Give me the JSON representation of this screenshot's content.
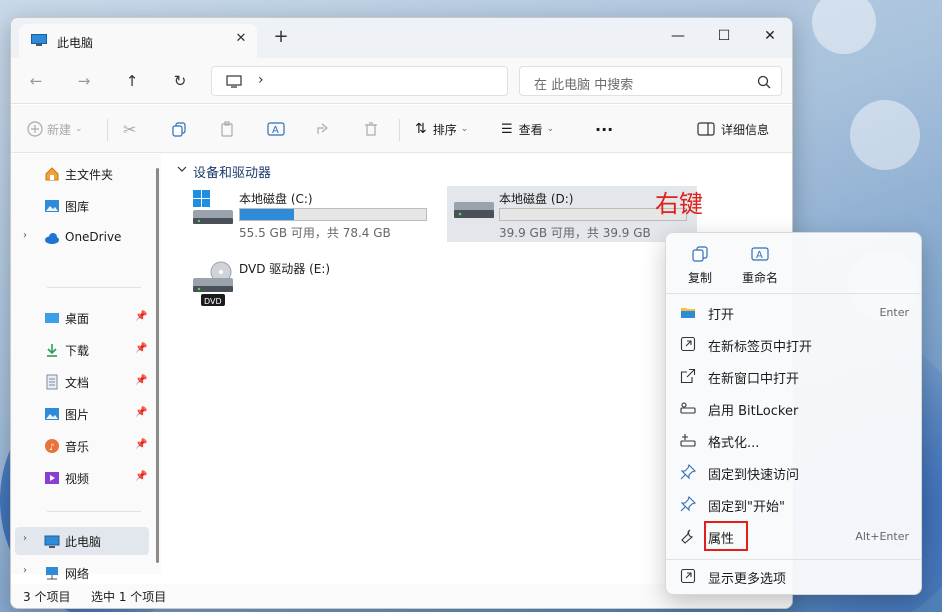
{
  "window": {
    "tab_title": "此电脑",
    "tab_close": "✕",
    "new_tab": "+",
    "minimize": "—",
    "maximize": "☐",
    "close": "✕"
  },
  "address": {
    "chevron": "›",
    "search_placeholder": "在 此电脑 中搜索"
  },
  "toolbar": {
    "new_label": "新建",
    "sort_label": "排序",
    "view_label": "查看",
    "more_label": "···",
    "details_label": "详细信息"
  },
  "nav": {
    "items": [
      {
        "label": "主文件夹"
      },
      {
        "label": "图库"
      },
      {
        "label": "OneDrive"
      },
      {
        "label": "桌面"
      },
      {
        "label": "下载"
      },
      {
        "label": "文档"
      },
      {
        "label": "图片"
      },
      {
        "label": "音乐"
      },
      {
        "label": "视频"
      },
      {
        "label": "此电脑"
      },
      {
        "label": "网络"
      }
    ]
  },
  "content": {
    "group_header": "设备和驱动器",
    "drives": [
      {
        "name": "本地磁盘 (C:)",
        "info": "55.5 GB 可用，共 78.4 GB",
        "used_fraction": 0.29
      },
      {
        "name": "本地磁盘 (D:)",
        "info": "39.9 GB 可用，共 39.9 GB",
        "used_fraction": 0.0
      },
      {
        "name": "DVD 驱动器 (E:)",
        "badge": "DVD"
      }
    ]
  },
  "status": {
    "count": "3 个项目",
    "selected": "选中 1 个项目"
  },
  "annotation": "右键",
  "context_menu": {
    "top": [
      {
        "label": "复制"
      },
      {
        "label": "重命名"
      }
    ],
    "items": [
      {
        "label": "打开",
        "key": "Enter"
      },
      {
        "label": "在新标签页中打开",
        "key": ""
      },
      {
        "label": "在新窗口中打开",
        "key": ""
      },
      {
        "label": "启用 BitLocker",
        "key": ""
      },
      {
        "label": "格式化...",
        "key": ""
      },
      {
        "label": "固定到快速访问",
        "key": ""
      },
      {
        "label": "固定到\"开始\"",
        "key": ""
      },
      {
        "label": "属性",
        "key": "Alt+Enter"
      }
    ],
    "more": {
      "label": "显示更多选项"
    }
  },
  "colors": {
    "accent": "#2f8bd8",
    "highlight": "#e0201b"
  }
}
